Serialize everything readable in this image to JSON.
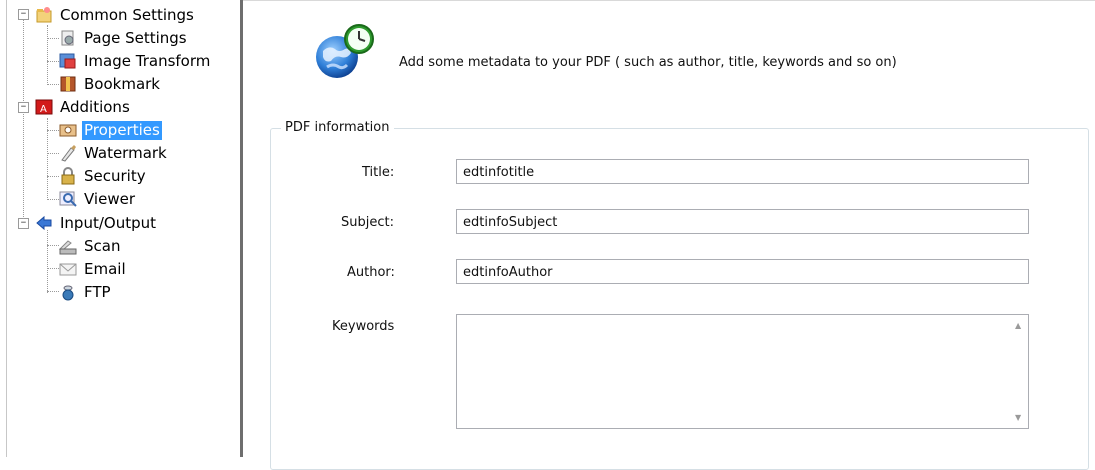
{
  "tree": {
    "groups": [
      {
        "label": "Common Settings",
        "icon": "settings-folder-icon",
        "children": [
          {
            "label": "Page Settings",
            "icon": "page-settings-icon"
          },
          {
            "label": "Image Transform",
            "icon": "image-transform-icon"
          },
          {
            "label": "Bookmark",
            "icon": "bookmark-icon"
          }
        ]
      },
      {
        "label": "Additions",
        "icon": "pdf-icon",
        "children": [
          {
            "label": "Properties",
            "icon": "properties-icon",
            "selected": true
          },
          {
            "label": "Watermark",
            "icon": "watermark-icon"
          },
          {
            "label": "Security",
            "icon": "security-lock-icon"
          },
          {
            "label": "Viewer",
            "icon": "viewer-icon"
          }
        ]
      },
      {
        "label": "Input/Output",
        "icon": "arrow-left-icon",
        "children": [
          {
            "label": "Scan",
            "icon": "scanner-icon"
          },
          {
            "label": "Email",
            "icon": "email-icon"
          },
          {
            "label": "FTP",
            "icon": "ftp-icon"
          }
        ]
      }
    ]
  },
  "header": {
    "icon": "globe-clock-icon",
    "text": "Add some metadata to your PDF ( such as author, title, keywords and so on)"
  },
  "pdf_info": {
    "group_title": "PDF information",
    "title_label": "Title:",
    "title_value": "edtinfotitle",
    "subject_label": "Subject:",
    "subject_value": "edtinfoSubject",
    "author_label": "Author:",
    "author_value": "edtinfoAuthor",
    "keywords_label": "Keywords",
    "keywords_value": ""
  },
  "colors": {
    "selection": "#3399ff",
    "splitter": "#6e6e6e",
    "groupbox_border": "#d5dfe5"
  }
}
